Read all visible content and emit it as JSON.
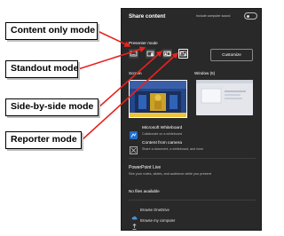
{
  "panel": {
    "title": "Share content",
    "include_sound_label": "Include computer sound",
    "presenter_mode_label": "Presenter mode",
    "customize_label": "Customize",
    "screen_label": "Screen",
    "window_label": "Window (5)"
  },
  "modes": [
    {
      "name": "Content only mode"
    },
    {
      "name": "Standout mode"
    },
    {
      "name": "Side-by-side mode"
    },
    {
      "name": "Reporter mode"
    }
  ],
  "list": {
    "whiteboard_title": "Microsoft Whiteboard",
    "whiteboard_sub": "Collaborate on a whiteboard",
    "camera_title": "Content from camera",
    "camera_sub": "Share a document, a whiteboard, and more"
  },
  "powerpoint": {
    "title": "PowerPoint Live",
    "subtitle": "See your notes, slides, and audience while you present",
    "no_files": "No files available",
    "browse_onedrive": "Browse OneDrive",
    "browse_computer": "Browse my computer"
  },
  "colors": {
    "panel_bg": "#292929",
    "arrow": "#e8231f",
    "accent": "#4a90d9"
  }
}
